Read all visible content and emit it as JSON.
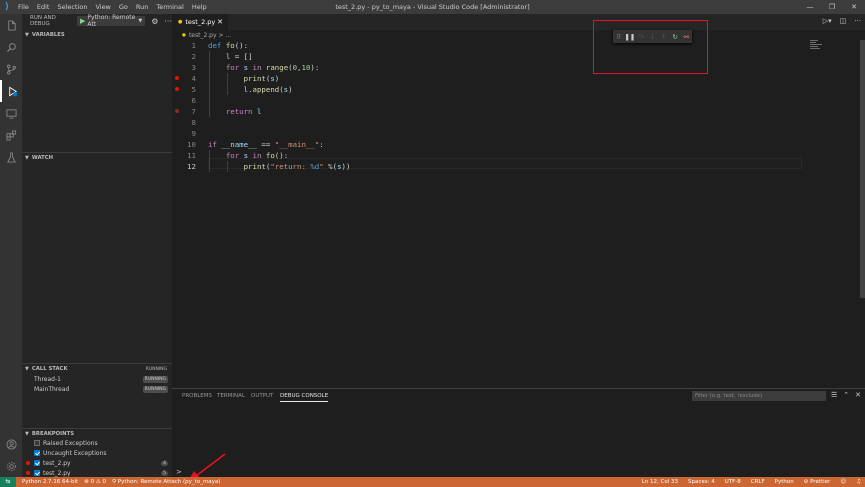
{
  "window": {
    "title": "test_2.py - py_to_maya - Visual Studio Code [Administrator]",
    "menu": [
      "File",
      "Edit",
      "Selection",
      "View",
      "Go",
      "Run",
      "Terminal",
      "Help"
    ]
  },
  "sidebar": {
    "header": "RUN AND DEBUG",
    "config": "Python: Remote Att",
    "sections": {
      "variables": "VARIABLES",
      "watch": "WATCH",
      "call_stack": "CALL STACK",
      "breakpoints": "BREAKPOINTS"
    },
    "call_stack_status": "RUNNING",
    "threads": [
      {
        "name": "Thread-1",
        "state": "RUNNING"
      },
      {
        "name": "MainThread",
        "state": "RUNNING"
      }
    ],
    "breakpoints": [
      {
        "label": "Raised Exceptions",
        "checked": false,
        "count": ""
      },
      {
        "label": "Uncaught Exceptions",
        "checked": true,
        "count": ""
      },
      {
        "label": "test_2.py",
        "checked": true,
        "count": "4"
      },
      {
        "label": "test_2.py",
        "checked": true,
        "count": "5"
      }
    ]
  },
  "editor": {
    "tab": "test_2.py",
    "breadcrumb": "test_2.py > ...",
    "line_numbers": [
      "1",
      "2",
      "3",
      "4",
      "5",
      "6",
      "7",
      "8",
      "9",
      "10",
      "11",
      "12"
    ],
    "current_line": 12,
    "breakpoint_lines": [
      4,
      5,
      7
    ]
  },
  "panel": {
    "tabs": [
      "PROBLEMS",
      "TERMINAL",
      "OUTPUT",
      "DEBUG CONSOLE"
    ],
    "active_tab": "DEBUG CONSOLE",
    "filter_placeholder": "Filter (e.g. text, !exclude)",
    "prompt": ">"
  },
  "statusbar": {
    "interpreter": "Python 2.7.16 64-bit",
    "problems": "⊗ 0 ⚠ 0",
    "debug_session": "Python: Remote Attach (py_to_maya)",
    "position": "Ln 12, Col 33",
    "spaces": "Spaces: 4",
    "encoding": "UTF-8",
    "eol": "CRLF",
    "language": "Python",
    "prettier": "⊘ Prettier"
  },
  "colors": {
    "statusbar_debug": "#cc6633",
    "highlight_box": "#e81123",
    "accent": "#007acc"
  }
}
